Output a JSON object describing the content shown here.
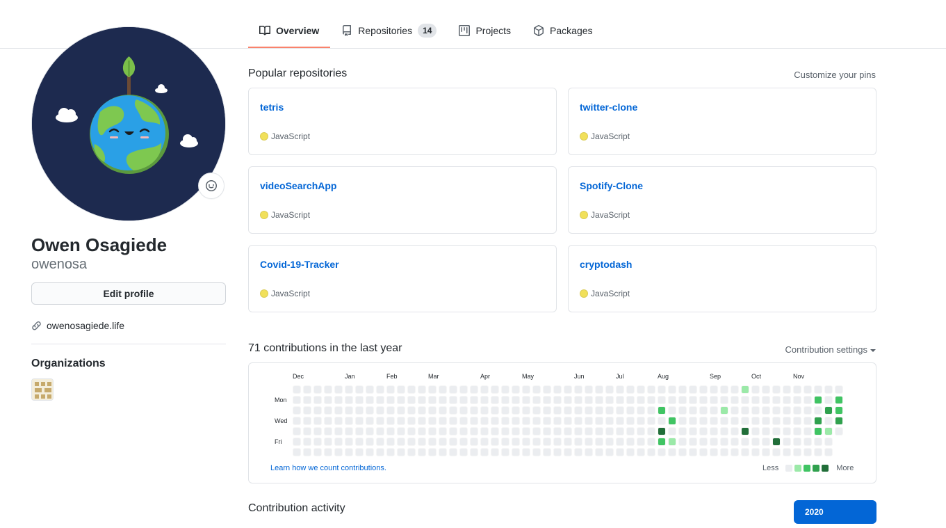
{
  "tabs": [
    {
      "label": "Overview",
      "icon": "book-icon",
      "active": true
    },
    {
      "label": "Repositories",
      "icon": "repo-icon",
      "counter": "14"
    },
    {
      "label": "Projects",
      "icon": "project-icon"
    },
    {
      "label": "Packages",
      "icon": "package-icon"
    }
  ],
  "profile": {
    "full_name": "Owen Osagiede",
    "username": "owenosa",
    "edit_label": "Edit profile",
    "website": "owenosagiede.life",
    "organizations_title": "Organizations"
  },
  "popular": {
    "title": "Popular repositories",
    "customize_label": "Customize your pins",
    "repos": [
      {
        "name": "tetris",
        "language": "JavaScript"
      },
      {
        "name": "twitter-clone",
        "language": "JavaScript"
      },
      {
        "name": "videoSearchApp",
        "language": "JavaScript"
      },
      {
        "name": "Spotify-Clone",
        "language": "JavaScript"
      },
      {
        "name": "Covid-19-Tracker",
        "language": "JavaScript"
      },
      {
        "name": "cryptodash",
        "language": "JavaScript"
      }
    ],
    "language_color": "#f1e05a"
  },
  "contributions": {
    "title": "71 contributions in the last year",
    "settings_label": "Contribution settings",
    "months": [
      "Dec",
      "Jan",
      "Feb",
      "Mar",
      "Apr",
      "May",
      "Jun",
      "Jul",
      "Aug",
      "Sep",
      "Oct",
      "Nov"
    ],
    "days": [
      "Mon",
      "Wed",
      "Fri"
    ],
    "learn_label": "Learn how we count contributions.",
    "legend_less": "Less",
    "legend_more": "More",
    "level_colors": [
      "#ebedf0",
      "#9be9a8",
      "#40c463",
      "#30a14e",
      "#216e39"
    ],
    "weeks": 53,
    "last_week_days": 5,
    "active_cells": [
      {
        "week": 35,
        "day": 2,
        "level": 2
      },
      {
        "week": 35,
        "day": 4,
        "level": 4
      },
      {
        "week": 35,
        "day": 5,
        "level": 2
      },
      {
        "week": 36,
        "day": 3,
        "level": 2
      },
      {
        "week": 36,
        "day": 5,
        "level": 1
      },
      {
        "week": 41,
        "day": 2,
        "level": 1
      },
      {
        "week": 43,
        "day": 0,
        "level": 1
      },
      {
        "week": 43,
        "day": 4,
        "level": 4
      },
      {
        "week": 46,
        "day": 5,
        "level": 4
      },
      {
        "week": 50,
        "day": 1,
        "level": 2
      },
      {
        "week": 50,
        "day": 3,
        "level": 3
      },
      {
        "week": 50,
        "day": 4,
        "level": 2
      },
      {
        "week": 51,
        "day": 2,
        "level": 3
      },
      {
        "week": 51,
        "day": 4,
        "level": 1
      },
      {
        "week": 52,
        "day": 1,
        "level": 2
      },
      {
        "week": 52,
        "day": 2,
        "level": 2
      },
      {
        "week": 52,
        "day": 3,
        "level": 3
      }
    ]
  },
  "activity": {
    "title": "Contribution activity",
    "year": "2020"
  }
}
